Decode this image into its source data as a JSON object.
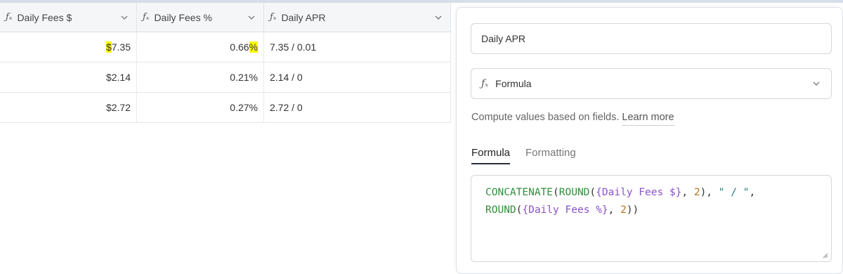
{
  "grid": {
    "columns": [
      {
        "label": "Daily Fees $",
        "icon": "formula-icon"
      },
      {
        "label": "Daily Fees %",
        "icon": "formula-icon"
      },
      {
        "label": "Daily APR",
        "icon": "formula-icon"
      }
    ],
    "rows": [
      {
        "fees_dollar_prefix": "$",
        "fees_dollar_rest": "7.35",
        "fees_pct_num": "0.66",
        "fees_pct_suffix": "%",
        "apr": "7.35 / 0.01"
      },
      {
        "fees_dollar_prefix": "$",
        "fees_dollar_rest": "2.14",
        "fees_pct_num": "0.21",
        "fees_pct_suffix": "%",
        "apr": "2.14 / 0"
      },
      {
        "fees_dollar_prefix": "$",
        "fees_dollar_rest": "2.72",
        "fees_pct_num": "0.27",
        "fees_pct_suffix": "%",
        "apr": "2.72 / 0"
      }
    ],
    "highlight_color": "#fbf700"
  },
  "panel": {
    "field_name": "Daily APR",
    "field_type": "Formula",
    "description": "Compute values based on fields.",
    "learn_more": "Learn more",
    "tabs": [
      {
        "label": "Formula",
        "active": true
      },
      {
        "label": "Formatting",
        "active": false
      }
    ],
    "formula": {
      "f1": "CONCATENATE",
      "p1": "(",
      "f2": "ROUND",
      "p2": "(",
      "field1": "{Daily Fees $}",
      "p3": ", ",
      "n1": "2",
      "p4": "), ",
      "str1": "\" / \"",
      "p5": ",",
      "f3": "ROUND",
      "p6": "(",
      "field2": "{Daily Fees %}",
      "p7": ", ",
      "n2": "2",
      "p8": "))"
    }
  }
}
